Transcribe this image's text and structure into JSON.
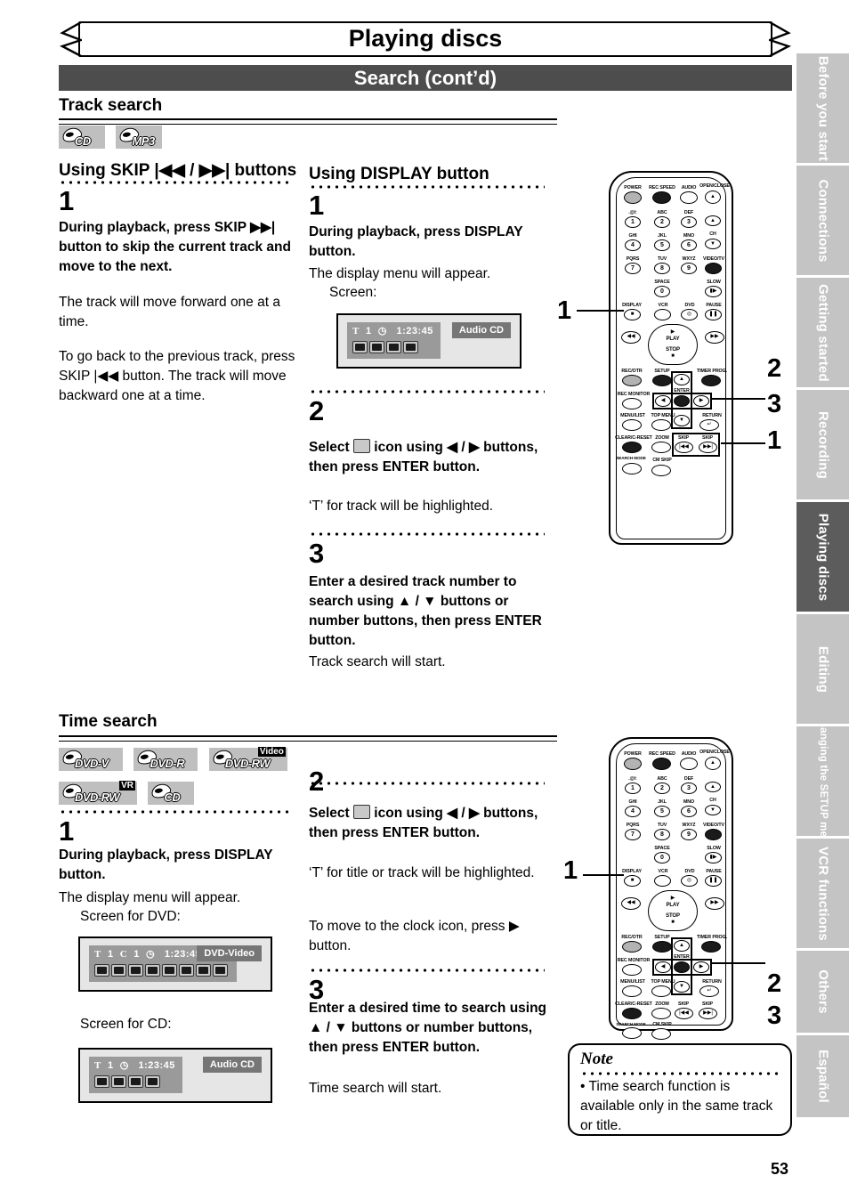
{
  "header": {
    "page_title": "Playing discs",
    "section_title": "Search (cont’d)"
  },
  "track_search": {
    "heading": "Track search",
    "badges": [
      {
        "label": "CD",
        "sup": ""
      },
      {
        "label": "MP3",
        "sup": ""
      }
    ],
    "left_column": {
      "heading": "Using SKIP |◀◀ / ▶▶| buttons",
      "step_number": "1",
      "bold_text": "During playback, press SKIP ▶▶| button to skip the current track and move to the next.",
      "para1": "The track will move forward one at a time.",
      "para2": "To go back to the previous track, press SKIP |◀◀ button. The track will move backward one at a time."
    },
    "middle_column": {
      "heading": "Using DISPLAY button",
      "steps": [
        {
          "number": "1",
          "bold_text": "During playback, press DISPLAY button.",
          "para": "The display menu will appear.",
          "screen_caption": "Screen:"
        },
        {
          "number": "2",
          "bold_text": "Select  icon using ◀ / ▶ buttons, then press ENTER button.",
          "para": "‘T’ for track will be highlighted."
        },
        {
          "number": "3",
          "bold_text": "Enter a desired track number to search using ▲ / ▼ buttons or number buttons, then press ENTER button.",
          "para": "Track search will start."
        }
      ]
    },
    "osd_screen": {
      "title_letter": "T",
      "title_number": "1",
      "clock_icon": "clock-icon",
      "time": "1:23:45",
      "disc_tag": "Audio CD",
      "icon_count": 4
    },
    "callouts": [
      "1",
      "2",
      "3",
      "1"
    ]
  },
  "time_search": {
    "heading": "Time search",
    "badges": [
      {
        "label": "DVD-V",
        "sup": ""
      },
      {
        "label": "DVD-R",
        "sup": ""
      },
      {
        "label": "DVD-RW",
        "sup": "Video"
      },
      {
        "label": "DVD-RW",
        "sup": "VR"
      },
      {
        "label": "CD",
        "sup": ""
      }
    ],
    "left_column": {
      "step_number": "1",
      "bold_text": "During playback, press DISPLAY button.",
      "para": "The display menu will appear.",
      "caption_dvd": "Screen for DVD:",
      "caption_cd": "Screen for CD:"
    },
    "middle_column": {
      "steps": [
        {
          "number": "2",
          "bold_text": "Select  icon using ◀ / ▶ buttons, then press ENTER button.",
          "para1": "‘T’ for title or track will be highlighted.",
          "para2": "To move to the clock icon, press ▶ button."
        },
        {
          "number": "3",
          "bold_text": "Enter a desired time to search using ▲ / ▼ buttons or number buttons, then press ENTER button.",
          "para": "Time search will start."
        }
      ]
    },
    "osd_dvd": {
      "title_letter": "T",
      "title_number": "1",
      "chapter_letter": "C",
      "chapter_number": "1",
      "time": "1:23:45",
      "disc_tag": "DVD-Video",
      "icon_count": 8
    },
    "osd_cd": {
      "title_letter": "T",
      "title_number": "1",
      "time": "1:23:45",
      "disc_tag": "Audio CD",
      "icon_count": 4
    },
    "callouts": [
      "1",
      "2",
      "3"
    ]
  },
  "note": {
    "title": "Note",
    "text": "• Time search function is available only in the same track or title."
  },
  "remote": {
    "rows": {
      "top_labels": [
        "POWER",
        "REC SPEED",
        "AUDIO",
        "OPEN/CLOSE"
      ],
      "num_labels": [
        ".@/:",
        "ABC",
        "DEF",
        "GHI",
        "JKL",
        "MNO",
        "PQRS",
        "TUV",
        "WXYZ",
        "SPACE"
      ],
      "numbers": [
        "1",
        "2",
        "3",
        "4",
        "5",
        "6",
        "7",
        "8",
        "9",
        "0"
      ],
      "ch_label": "CH",
      "video_tv": "VIDEO/TV",
      "slow": "SLOW",
      "display": "DISPLAY",
      "vcr": "VCR",
      "dvd": "DVD",
      "pause": "PAUSE",
      "play": "PLAY",
      "stop": "STOP",
      "rec_otr": "REC/OTR",
      "setup": "SETUP",
      "timer_prog": "TIMER PROG.",
      "rec_monitor": "REC MONITOR",
      "enter": "ENTER",
      "menu_list": "MENU/LIST",
      "top_menu": "TOP MENU",
      "return": "RETURN",
      "clear_c_reset": "CLEAR/C-RESET",
      "zoom": "ZOOM",
      "skip_left": "SKIP",
      "skip_right": "SKIP",
      "search_mode": "SEARCH MODE",
      "cm_skip": "CM SKIP"
    }
  },
  "sidebar": {
    "tabs": [
      {
        "label": "Before you start",
        "active": false,
        "small": false
      },
      {
        "label": "Connections",
        "active": false,
        "small": false
      },
      {
        "label": "Getting started",
        "active": false,
        "small": false
      },
      {
        "label": "Recording",
        "active": false,
        "small": false
      },
      {
        "label": "Playing discs",
        "active": true,
        "small": false
      },
      {
        "label": "Editing",
        "active": false,
        "small": false
      },
      {
        "label": "Changing the SETUP menu",
        "active": false,
        "small": true
      },
      {
        "label": "VCR functions",
        "active": false,
        "small": false
      },
      {
        "label": "Others",
        "active": false,
        "small": false
      },
      {
        "label": "Español",
        "active": false,
        "small": false
      }
    ]
  },
  "footer": {
    "page_number": "53"
  }
}
